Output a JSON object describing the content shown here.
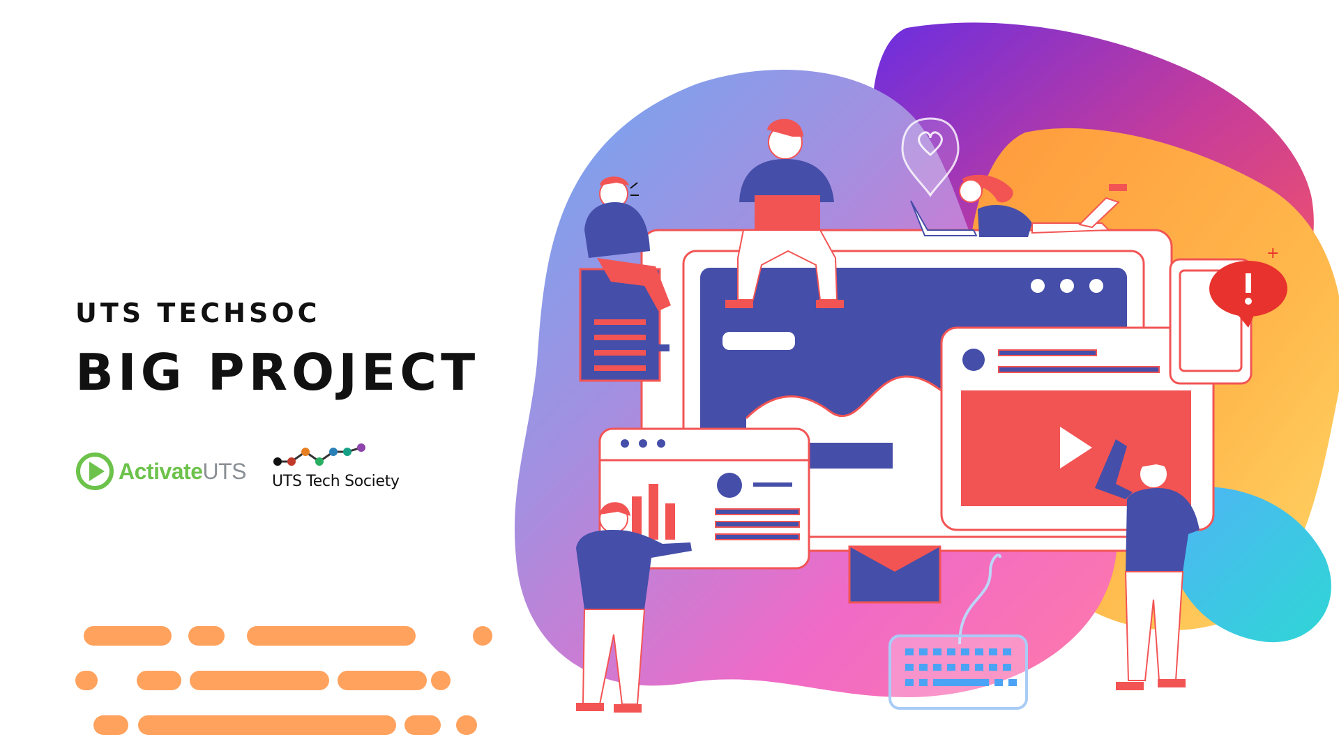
{
  "slide": {
    "kicker": "UTS TECHSOC",
    "headline": "BIG PROJECT"
  },
  "logos": {
    "activate": {
      "brand": "Activate",
      "suffix": "UTS"
    },
    "techsoc": {
      "name": "UTS Tech Society"
    }
  },
  "colors": {
    "text": "#111111",
    "accent_orange": "#ffa25e",
    "activate_green": "#6cc24a",
    "illustration_navy": "#454ea8",
    "illustration_red": "#f25454"
  },
  "illustration": {
    "icons": [
      "heart-pin-icon",
      "play-icon",
      "envelope-icon",
      "keyboard-icon",
      "alert-bubble-icon",
      "bar-chart-icon"
    ]
  }
}
